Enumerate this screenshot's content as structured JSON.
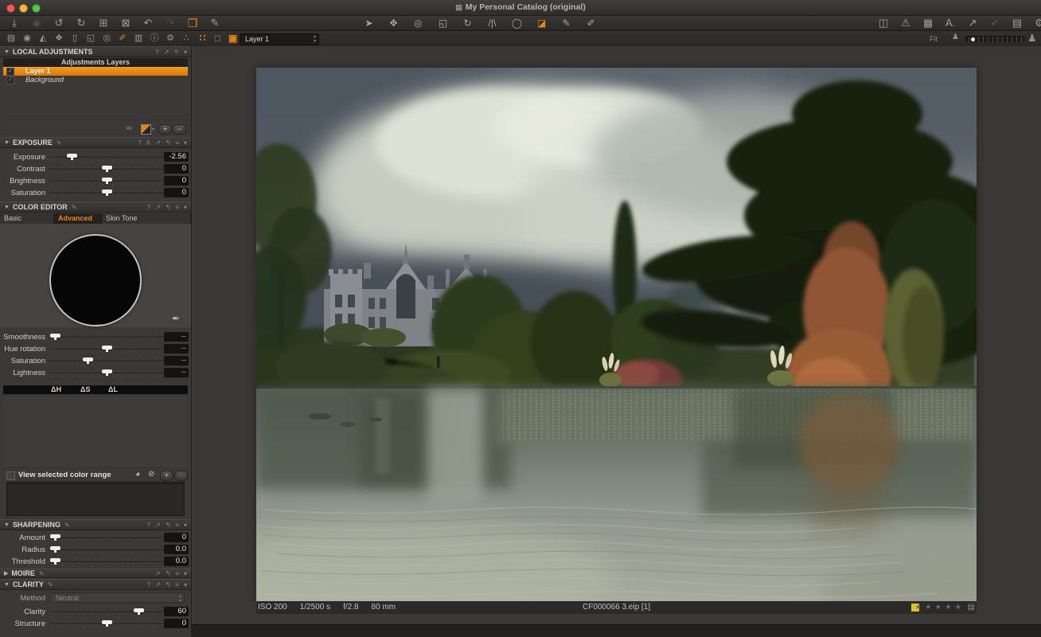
{
  "accent": "#e8860c",
  "window": {
    "title": "My Personal Catalog (original)",
    "icon": "▤"
  },
  "toolbar": {
    "import": "⤓",
    "capture": "◉",
    "rotate_ccw": "↺",
    "rotate_cw": "↻",
    "move_folder": "⊞",
    "trash": "⊠",
    "undo": "↶",
    "redo": "↷",
    "clone": "❐",
    "styles": "✎",
    "tools": {
      "cursor": "➤",
      "pan": "✥",
      "loupe": "◎",
      "crop": "◱",
      "rotate": "↻",
      "straighten": "/|\\",
      "circle": "◯",
      "gradient": "◪",
      "draw_mask": "✎",
      "erase_mask": "✐"
    },
    "right": {
      "levels": "◫",
      "warning": "⚠",
      "grid": "▦",
      "proof": "A.",
      "share": "↗",
      "check": "✔",
      "print": "▤",
      "gear": "⚙"
    }
  },
  "subbar": {
    "tabs": {
      "library": "▤",
      "capture": "◉",
      "quick": "◭",
      "color": "❖",
      "exposure": "▯",
      "crop": "◱",
      "loupe": "◎",
      "local": "✐",
      "metadata": "▥",
      "info": "ⓘ",
      "settings": "⚙",
      "process": "∴"
    },
    "views": {
      "multi": "∷",
      "single": "□",
      "framed": "▣"
    },
    "layer_select": "Layer 1",
    "stepper": "▴▾",
    "fit_label": "Fit",
    "person_small": "♟",
    "person_big": "♟"
  },
  "panels": {
    "local_adjustments": {
      "title": "LOCAL ADJUSTMENTS",
      "caret": "▼",
      "icons": [
        "?",
        "↗",
        "↰",
        "▾"
      ],
      "list_header": "Adjustments Layers",
      "layers": [
        {
          "check": "✓",
          "name": "Layer 1"
        },
        {
          "check": "✓",
          "name": "Background"
        }
      ],
      "footer": {
        "blend": "≂",
        "caret": "▾",
        "add": "+",
        "remove": "−"
      }
    },
    "exposure": {
      "title": "EXPOSURE",
      "caret": "▼",
      "edit": "✎",
      "icons": [
        "?",
        "A",
        "↗",
        "↰",
        "≡",
        "▾"
      ],
      "sliders": [
        {
          "label": "Exposure",
          "value": "-2.56",
          "pos": 19
        },
        {
          "label": "Contrast",
          "value": "0",
          "pos": 50
        },
        {
          "label": "Brightness",
          "value": "0",
          "pos": 50
        },
        {
          "label": "Saturation",
          "value": "0",
          "pos": 50
        }
      ]
    },
    "color_editor": {
      "title": "COLOR EDITOR",
      "caret": "▼",
      "edit": "✎",
      "icons": [
        "?",
        "↗",
        "↰",
        "≡",
        "▾"
      ],
      "tabs": [
        "Basic",
        "Advanced",
        "Skin Tone"
      ],
      "active_tab": "Advanced",
      "picker": "✒",
      "sliders": [
        {
          "label": "Smoothness",
          "value": "--",
          "pos": 4
        },
        {
          "label": "Hue rotation",
          "value": "--",
          "pos": 50
        },
        {
          "label": "Saturation",
          "value": "--",
          "pos": 33
        },
        {
          "label": "Lightness",
          "value": "--",
          "pos": 50
        }
      ],
      "deltas": [
        "ΔH",
        "ΔS",
        "ΔL"
      ],
      "range": {
        "label": "View selected color range",
        "pie": "◕",
        "slash": "⊘",
        "add": "+",
        "remove": "−"
      }
    },
    "sharpening": {
      "title": "SHARPENING",
      "caret": "▼",
      "edit": "✎",
      "icons": [
        "?",
        "↗",
        "↰",
        "≡",
        "▾"
      ],
      "sliders": [
        {
          "label": "Amount",
          "value": "0",
          "pos": 4
        },
        {
          "label": "Radius",
          "value": "0.0",
          "pos": 4
        },
        {
          "label": "Threshold",
          "value": "0.0",
          "pos": 4
        }
      ]
    },
    "moire": {
      "title": "MOIRE",
      "caret": "▶",
      "edit": "✎",
      "icons": [
        "↗",
        "↰",
        "≡",
        "▾"
      ]
    },
    "clarity": {
      "title": "CLARITY",
      "caret": "▼",
      "edit": "✎",
      "icons": [
        "?",
        "↗",
        "↰",
        "≡",
        "▾"
      ],
      "method_label": "Method",
      "method_value": "Neutral",
      "stepper": "▴▾",
      "sliders": [
        {
          "label": "Clarity",
          "value": "60",
          "pos": 78
        },
        {
          "label": "Structure",
          "value": "0",
          "pos": 50
        }
      ]
    }
  },
  "status": {
    "iso": "ISO 200",
    "shutter": "1/2500 s",
    "aperture": "f/2.8",
    "focal": "80 mm",
    "filename": "CF000066 3.eip [1]",
    "stars": "★ ★ ★ ★ ★",
    "badge": "▤",
    "tag_color": "#d8c520"
  },
  "photo": {
    "alt": "Lake with gothic country house, autumn trees and dramatic clouds"
  }
}
